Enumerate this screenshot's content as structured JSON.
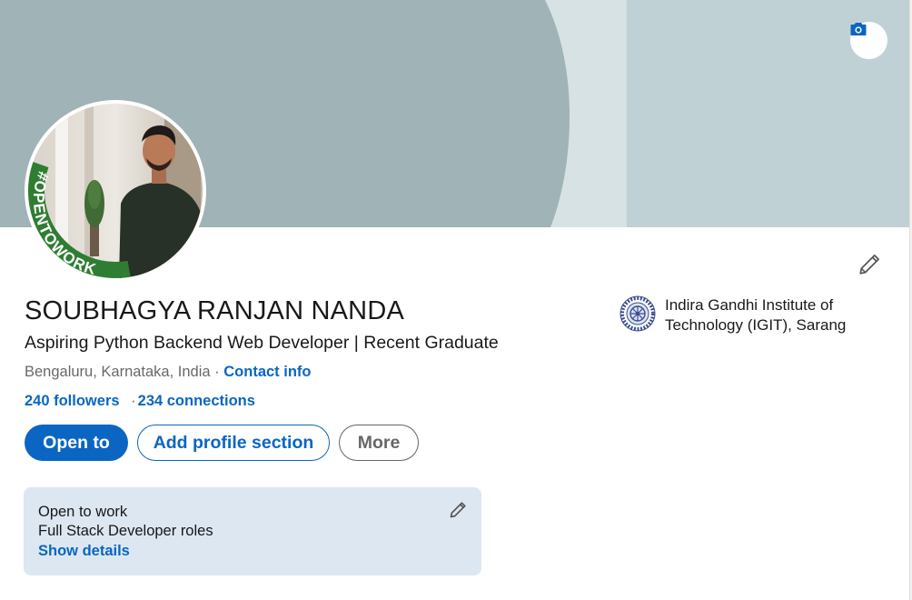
{
  "profile": {
    "name": "SOUBHAGYA RANJAN NANDA",
    "headline": "Aspiring Python Backend Web Developer | Recent Graduate",
    "location": "Bengaluru, Karnataka, India",
    "location_separator": "·",
    "contact_label": "Contact info",
    "followers": "240 followers",
    "network_separator": "·",
    "connections": "234 connections",
    "open_to_work_badge": "#OPENTOWORK"
  },
  "actions": {
    "open_to": "Open to",
    "add_profile_section": "Add profile section",
    "more": "More"
  },
  "education": {
    "name": "Indira Gandhi Institute of Technology (IGIT), Sarang"
  },
  "open_to_work": {
    "title": "Open to work",
    "roles": "Full Stack Developer roles",
    "show_details": "Show details"
  },
  "icons": {
    "banner_camera": "camera-icon",
    "edit_intro": "pencil-icon",
    "edit_open_to_work": "pencil-icon"
  },
  "colors": {
    "brand_blue": "#0a66c2",
    "open_to_work_green": "#2f7d32",
    "card_bg": "#dde7f1",
    "banner_dark": "#a0b3b6",
    "banner_light": "#c0d1d6"
  }
}
